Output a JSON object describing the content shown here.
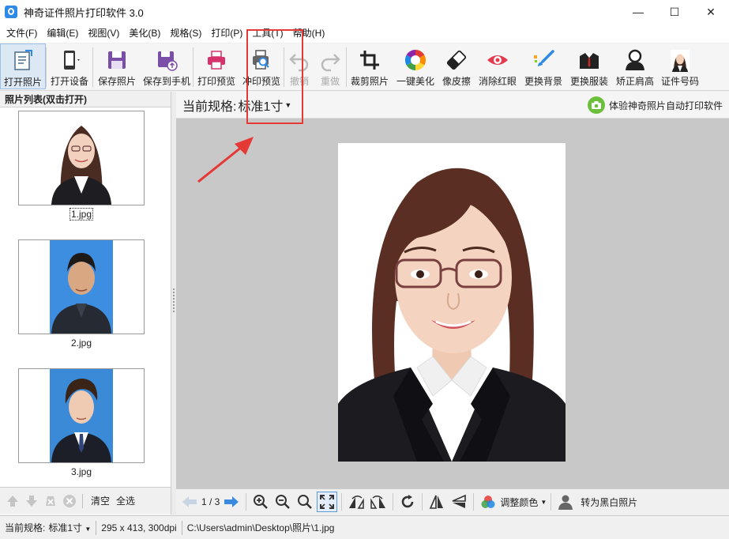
{
  "window": {
    "title": "神奇证件照片打印软件 3.0",
    "minimize": "—",
    "maximize": "☐",
    "close": "✕"
  },
  "menu": [
    "文件(F)",
    "编辑(E)",
    "视图(V)",
    "美化(B)",
    "规格(S)",
    "打印(P)",
    "工具(T)",
    "帮助(H)"
  ],
  "toolbar": {
    "open_photo": "打开照片",
    "open_device": "打开设备",
    "save_photo": "保存照片",
    "save_to_phone": "保存到手机",
    "print_preview": "打印预览",
    "develop_preview": "冲印预览",
    "undo": "撤销",
    "redo": "重做",
    "crop": "裁剪照片",
    "beautify": "一键美化",
    "eraser": "像皮擦",
    "red_eye": "消除红眼",
    "change_bg": "更换背景",
    "change_clothes": "更换服装",
    "fix_shoulder": "矫正肩高",
    "id_number": "证件号码"
  },
  "left_panel": {
    "header": "照片列表(双击打开)",
    "photos": [
      {
        "label": "1.jpg",
        "bg": "#ffffff"
      },
      {
        "label": "2.jpg",
        "bg": "#3d8ee0"
      },
      {
        "label": "3.jpg",
        "bg": "#3a8ad8"
      }
    ],
    "clear": "清空",
    "select_all": "全选"
  },
  "right_panel": {
    "spec_label": "当前规格:",
    "spec_value": "标准1寸",
    "promo": "体验神奇照片自动打印软件",
    "page": "1 / 3",
    "adjust_color": "调整颜色",
    "to_bw": "转为黑白照片"
  },
  "statusbar": {
    "spec_label": "当前规格:",
    "spec_value": "标准1寸",
    "dims": "295 x 413, 300dpi",
    "path": "C:\\Users\\admin\\Desktop\\照片\\1.jpg"
  },
  "colors": {
    "highlight": "#e53935",
    "accent": "#2e8ae6"
  }
}
